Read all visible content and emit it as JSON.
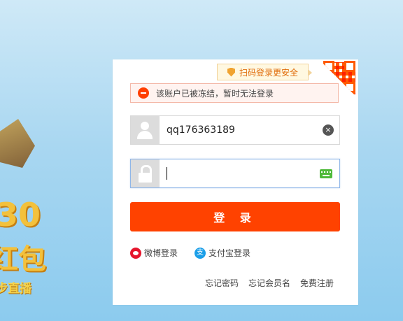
{
  "promo": {
    "number": "30",
    "redpacket": "红包",
    "live": "步直播"
  },
  "qr_tip": {
    "label": "扫码登录更安全"
  },
  "error": {
    "message": "该账户已被冻结，暂时无法登录"
  },
  "username": {
    "value": "qq176363189",
    "clear_icon": "×"
  },
  "password": {
    "value": ""
  },
  "login_button": {
    "label": "登 录"
  },
  "socials": {
    "weibo": "微博登录",
    "alipay": "支付宝登录",
    "alipay_icon_glyph": "支"
  },
  "links": {
    "forgot_password": "忘记密码",
    "forgot_member": "忘记会员名",
    "register": "免费注册"
  },
  "colors": {
    "accent": "#ff4200",
    "error_icon": "#ff3e00",
    "qr_tip_text": "#e06d0c",
    "keyboard_icon": "#4fba3a"
  }
}
